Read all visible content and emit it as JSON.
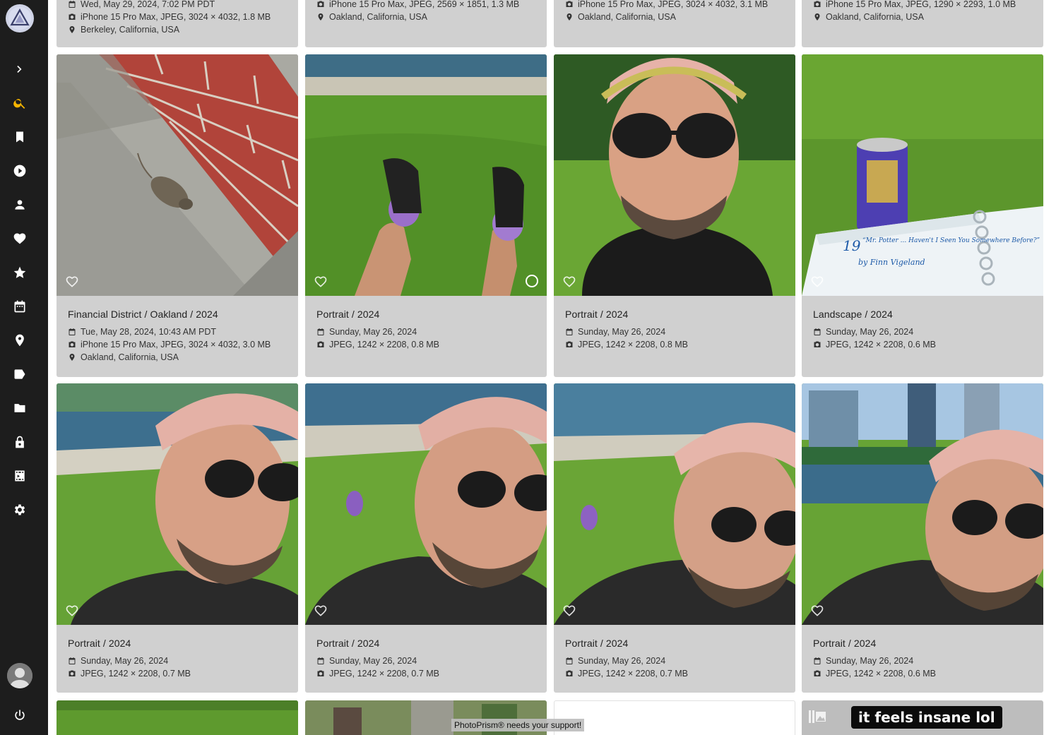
{
  "app": {
    "support_text": "PhotoPrism® needs your support!"
  },
  "colors": {
    "sidebar_bg": "#1d1d1d",
    "accent": "#f7b500",
    "card_bg": "#d0d0d0"
  },
  "sidebar": {
    "items": [
      {
        "icon": "chevron-right-icon"
      },
      {
        "icon": "search-icon"
      },
      {
        "icon": "bookmark-icon"
      },
      {
        "icon": "play-circle-icon"
      },
      {
        "icon": "person-icon"
      },
      {
        "icon": "heart-icon"
      },
      {
        "icon": "star-icon"
      },
      {
        "icon": "calendar-icon"
      },
      {
        "icon": "location-pin-icon"
      },
      {
        "icon": "label-icon"
      },
      {
        "icon": "folder-icon"
      },
      {
        "icon": "lock-icon"
      },
      {
        "icon": "library-icon"
      },
      {
        "icon": "gear-icon"
      },
      {
        "icon": "power-icon"
      }
    ]
  },
  "top_row": [
    {
      "date": "Wed, May 29, 2024, 7:02 PM PDT",
      "camera": "iPhone 15 Pro Max, JPEG, 3024 × 4032, 1.8 MB",
      "location": "Berkeley, California, USA"
    },
    {
      "camera": "iPhone 15 Pro Max, JPEG, 2569 × 1851, 1.3 MB",
      "location": "Oakland, California, USA"
    },
    {
      "camera": "iPhone 15 Pro Max, JPEG, 3024 × 4032, 3.1 MB",
      "location": "Oakland, California, USA"
    },
    {
      "camera": "iPhone 15 Pro Max, JPEG, 1290 × 2293, 1.0 MB",
      "location": "Oakland, California, USA"
    }
  ],
  "row1": [
    {
      "title": "Financial District / Oakland / 2024",
      "date": "Tue, May 28, 2024, 10:43 AM PDT",
      "camera": "iPhone 15 Pro Max, JPEG, 3024 × 4032, 3.0 MB",
      "location": "Oakland, California, USA"
    },
    {
      "title": "Portrait / 2024",
      "date": "Sunday, May 26, 2024",
      "camera": "JPEG, 1242 × 2208, 0.8 MB"
    },
    {
      "title": "Portrait / 2024",
      "date": "Sunday, May 26, 2024",
      "camera": "JPEG, 1242 × 2208, 0.8 MB"
    },
    {
      "title": "Landscape / 2024",
      "date": "Sunday, May 26, 2024",
      "camera": "JPEG, 1242 × 2208, 0.6 MB"
    }
  ],
  "row2": [
    {
      "title": "Portrait / 2024",
      "date": "Sunday, May 26, 2024",
      "camera": "JPEG, 1242 × 2208, 0.7 MB"
    },
    {
      "title": "Portrait / 2024",
      "date": "Sunday, May 26, 2024",
      "camera": "JPEG, 1242 × 2208, 0.7 MB"
    },
    {
      "title": "Portrait / 2024",
      "date": "Sunday, May 26, 2024",
      "camera": "JPEG, 1242 × 2208, 0.7 MB"
    },
    {
      "title": "Portrait / 2024",
      "date": "Sunday, May 26, 2024",
      "camera": "JPEG, 1242 × 2208, 0.6 MB"
    }
  ],
  "book_text": {
    "number": "19",
    "heading": "“Mr. Potter ... Haven't I Seen You Somewhere Before?”",
    "byline": "by Finn Vigeland"
  },
  "bottom_caption": "it feels insane lol"
}
